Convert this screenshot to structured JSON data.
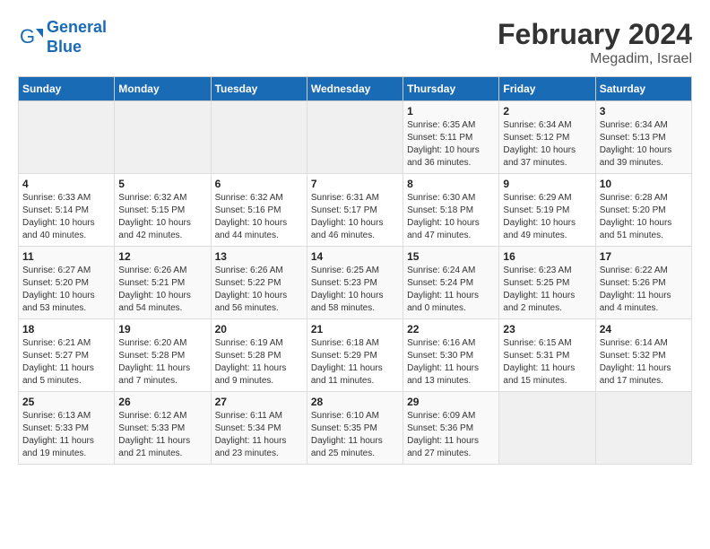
{
  "header": {
    "logo_line1": "General",
    "logo_line2": "Blue",
    "month_year": "February 2024",
    "location": "Megadim, Israel"
  },
  "weekdays": [
    "Sunday",
    "Monday",
    "Tuesday",
    "Wednesday",
    "Thursday",
    "Friday",
    "Saturday"
  ],
  "weeks": [
    [
      {
        "day": "",
        "sunrise": "",
        "sunset": "",
        "daylight": "",
        "empty": true
      },
      {
        "day": "",
        "sunrise": "",
        "sunset": "",
        "daylight": "",
        "empty": true
      },
      {
        "day": "",
        "sunrise": "",
        "sunset": "",
        "daylight": "",
        "empty": true
      },
      {
        "day": "",
        "sunrise": "",
        "sunset": "",
        "daylight": "",
        "empty": true
      },
      {
        "day": "1",
        "sunrise": "Sunrise: 6:35 AM",
        "sunset": "Sunset: 5:11 PM",
        "daylight": "Daylight: 10 hours and 36 minutes."
      },
      {
        "day": "2",
        "sunrise": "Sunrise: 6:34 AM",
        "sunset": "Sunset: 5:12 PM",
        "daylight": "Daylight: 10 hours and 37 minutes."
      },
      {
        "day": "3",
        "sunrise": "Sunrise: 6:34 AM",
        "sunset": "Sunset: 5:13 PM",
        "daylight": "Daylight: 10 hours and 39 minutes."
      }
    ],
    [
      {
        "day": "4",
        "sunrise": "Sunrise: 6:33 AM",
        "sunset": "Sunset: 5:14 PM",
        "daylight": "Daylight: 10 hours and 40 minutes."
      },
      {
        "day": "5",
        "sunrise": "Sunrise: 6:32 AM",
        "sunset": "Sunset: 5:15 PM",
        "daylight": "Daylight: 10 hours and 42 minutes."
      },
      {
        "day": "6",
        "sunrise": "Sunrise: 6:32 AM",
        "sunset": "Sunset: 5:16 PM",
        "daylight": "Daylight: 10 hours and 44 minutes."
      },
      {
        "day": "7",
        "sunrise": "Sunrise: 6:31 AM",
        "sunset": "Sunset: 5:17 PM",
        "daylight": "Daylight: 10 hours and 46 minutes."
      },
      {
        "day": "8",
        "sunrise": "Sunrise: 6:30 AM",
        "sunset": "Sunset: 5:18 PM",
        "daylight": "Daylight: 10 hours and 47 minutes."
      },
      {
        "day": "9",
        "sunrise": "Sunrise: 6:29 AM",
        "sunset": "Sunset: 5:19 PM",
        "daylight": "Daylight: 10 hours and 49 minutes."
      },
      {
        "day": "10",
        "sunrise": "Sunrise: 6:28 AM",
        "sunset": "Sunset: 5:20 PM",
        "daylight": "Daylight: 10 hours and 51 minutes."
      }
    ],
    [
      {
        "day": "11",
        "sunrise": "Sunrise: 6:27 AM",
        "sunset": "Sunset: 5:20 PM",
        "daylight": "Daylight: 10 hours and 53 minutes."
      },
      {
        "day": "12",
        "sunrise": "Sunrise: 6:26 AM",
        "sunset": "Sunset: 5:21 PM",
        "daylight": "Daylight: 10 hours and 54 minutes."
      },
      {
        "day": "13",
        "sunrise": "Sunrise: 6:26 AM",
        "sunset": "Sunset: 5:22 PM",
        "daylight": "Daylight: 10 hours and 56 minutes."
      },
      {
        "day": "14",
        "sunrise": "Sunrise: 6:25 AM",
        "sunset": "Sunset: 5:23 PM",
        "daylight": "Daylight: 10 hours and 58 minutes."
      },
      {
        "day": "15",
        "sunrise": "Sunrise: 6:24 AM",
        "sunset": "Sunset: 5:24 PM",
        "daylight": "Daylight: 11 hours and 0 minutes."
      },
      {
        "day": "16",
        "sunrise": "Sunrise: 6:23 AM",
        "sunset": "Sunset: 5:25 PM",
        "daylight": "Daylight: 11 hours and 2 minutes."
      },
      {
        "day": "17",
        "sunrise": "Sunrise: 6:22 AM",
        "sunset": "Sunset: 5:26 PM",
        "daylight": "Daylight: 11 hours and 4 minutes."
      }
    ],
    [
      {
        "day": "18",
        "sunrise": "Sunrise: 6:21 AM",
        "sunset": "Sunset: 5:27 PM",
        "daylight": "Daylight: 11 hours and 5 minutes."
      },
      {
        "day": "19",
        "sunrise": "Sunrise: 6:20 AM",
        "sunset": "Sunset: 5:28 PM",
        "daylight": "Daylight: 11 hours and 7 minutes."
      },
      {
        "day": "20",
        "sunrise": "Sunrise: 6:19 AM",
        "sunset": "Sunset: 5:28 PM",
        "daylight": "Daylight: 11 hours and 9 minutes."
      },
      {
        "day": "21",
        "sunrise": "Sunrise: 6:18 AM",
        "sunset": "Sunset: 5:29 PM",
        "daylight": "Daylight: 11 hours and 11 minutes."
      },
      {
        "day": "22",
        "sunrise": "Sunrise: 6:16 AM",
        "sunset": "Sunset: 5:30 PM",
        "daylight": "Daylight: 11 hours and 13 minutes."
      },
      {
        "day": "23",
        "sunrise": "Sunrise: 6:15 AM",
        "sunset": "Sunset: 5:31 PM",
        "daylight": "Daylight: 11 hours and 15 minutes."
      },
      {
        "day": "24",
        "sunrise": "Sunrise: 6:14 AM",
        "sunset": "Sunset: 5:32 PM",
        "daylight": "Daylight: 11 hours and 17 minutes."
      }
    ],
    [
      {
        "day": "25",
        "sunrise": "Sunrise: 6:13 AM",
        "sunset": "Sunset: 5:33 PM",
        "daylight": "Daylight: 11 hours and 19 minutes."
      },
      {
        "day": "26",
        "sunrise": "Sunrise: 6:12 AM",
        "sunset": "Sunset: 5:33 PM",
        "daylight": "Daylight: 11 hours and 21 minutes."
      },
      {
        "day": "27",
        "sunrise": "Sunrise: 6:11 AM",
        "sunset": "Sunset: 5:34 PM",
        "daylight": "Daylight: 11 hours and 23 minutes."
      },
      {
        "day": "28",
        "sunrise": "Sunrise: 6:10 AM",
        "sunset": "Sunset: 5:35 PM",
        "daylight": "Daylight: 11 hours and 25 minutes."
      },
      {
        "day": "29",
        "sunrise": "Sunrise: 6:09 AM",
        "sunset": "Sunset: 5:36 PM",
        "daylight": "Daylight: 11 hours and 27 minutes."
      },
      {
        "day": "",
        "sunrise": "",
        "sunset": "",
        "daylight": "",
        "empty": true
      },
      {
        "day": "",
        "sunrise": "",
        "sunset": "",
        "daylight": "",
        "empty": true
      }
    ]
  ]
}
